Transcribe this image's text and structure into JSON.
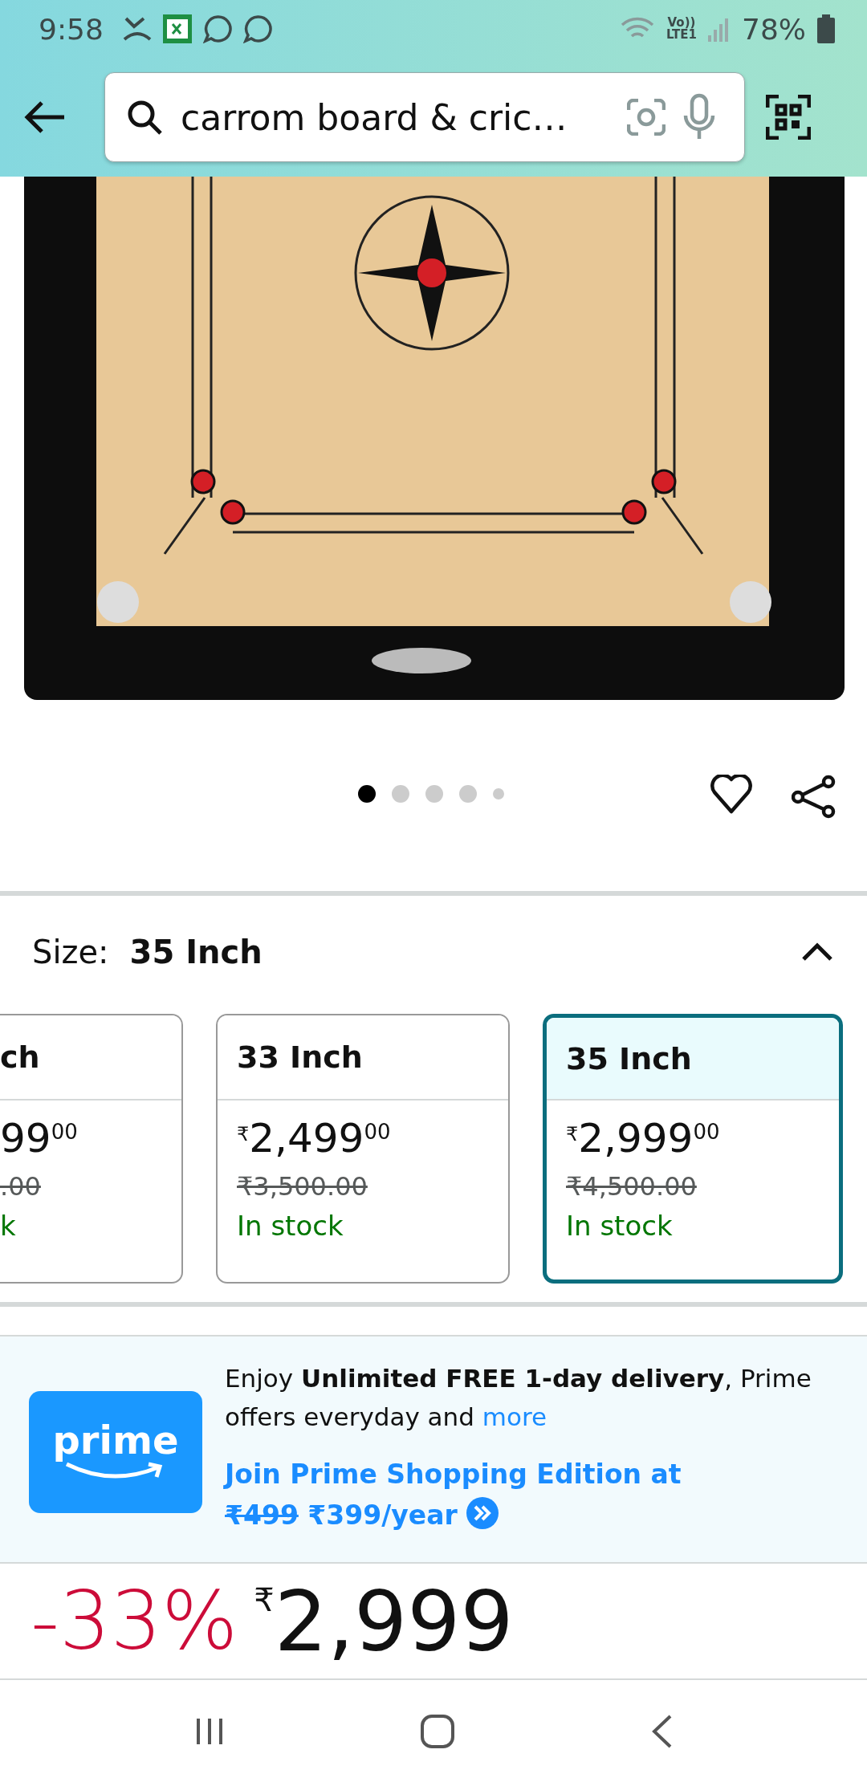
{
  "status_bar": {
    "time": "9:58",
    "volte_top": "Vo))",
    "volte_bottom": "LTE1",
    "battery": "78%"
  },
  "search": {
    "value": "carrom board & cric…"
  },
  "image_dots": [
    {
      "selected": true
    },
    {
      "selected": false
    },
    {
      "selected": false
    },
    {
      "selected": false
    },
    {
      "selected": false
    }
  ],
  "size_section": {
    "label": "Size:",
    "value": "35 Inch",
    "expanded": true,
    "options": [
      {
        "title": "ch",
        "price": "99",
        "paise": "00",
        "mrp": ".00",
        "stock": "k",
        "selected": false
      },
      {
        "title": "33 Inch",
        "currency": "₹",
        "price": "2,499",
        "paise": "00",
        "mrp": "₹3,500.00",
        "stock": "In stock",
        "selected": false
      },
      {
        "title": "35 Inch",
        "currency": "₹",
        "price": "2,999",
        "paise": "00",
        "mrp": "₹4,500.00",
        "stock": "In stock",
        "selected": true
      }
    ]
  },
  "prime": {
    "logo_text": "prime",
    "text": "Enjoy **Unlimited FREE 1-day delivery**, Prime offers everyday and",
    "more_link": "more",
    "join_text": "Join Prime Shopping Edition at",
    "old_price": "₹499",
    "new_price": "₹399/year"
  },
  "price": {
    "discount": "-33%",
    "currency": "₹",
    "amount": "2,999"
  }
}
